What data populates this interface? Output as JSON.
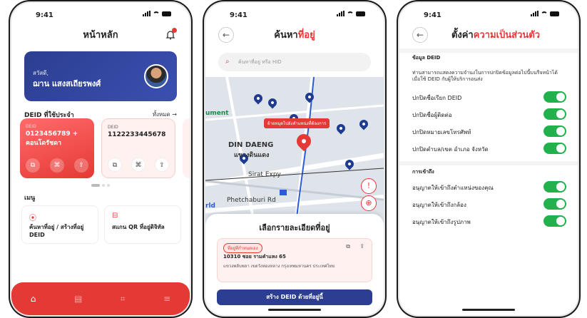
{
  "status": {
    "time": "9:41"
  },
  "home": {
    "title": "หน้าหลัก",
    "greeting": "สวัสดี,",
    "user_name": "ฌาน แสงสเถียรพงศ์",
    "deid_section": "DEID ที่ใช้ประจำ",
    "see_all": "ทั้งหมด →",
    "cards": [
      {
        "label": "DEID",
        "number": "0123456789 + คอนโดรัชดา"
      },
      {
        "label": "DEID",
        "number": "1122233445678"
      }
    ],
    "menu_section": "เมนู",
    "menu": [
      {
        "label": "ค้นหาที่อยู่ / สร้างที่อยู่ DEID"
      },
      {
        "label": "สแกน QR ที่อยู่ดิจิทัล"
      }
    ]
  },
  "search": {
    "title_plain": "ค้นหา",
    "title_accent": "ที่อยู่",
    "placeholder": "ค้นหาที่อยู่ หรือ HID",
    "map_tag": "ย้ายหมุดไปยังตำแหน่งที่ต้องการ",
    "map_labels": [
      "ument",
      "DIN DAENG",
      "แขวงดินแดง",
      "Sirat Expy",
      "Phetchaburi Rd",
      "rld"
    ],
    "sheet_title": "เลือกรายละเอียดที่อยู่",
    "address_badge": "ที่อยู่ที่กำหนดเอง",
    "address_line1": "10310 ซอย รามคำแหง 65",
    "address_line2": "แขวงพลับพลา เขตวังทองหลาง กรุงเทพมหานคร ประเทศไทย",
    "cta": "สร้าง DEID ด้วยที่อยู่นี้"
  },
  "privacy": {
    "title_plain": "ตั้งค่า",
    "title_accent": "ความเป็นส่วนตัว",
    "deid_group": "ข้อมูล DEID",
    "description": "ท่านสามารถแสดงความจำนงในการปกปิดข้อมูลต่อไปนี้บนรีจหน้าได้ เมื่อใช้ DEID กับผู้ให้บริการอนส่ง",
    "toggles": [
      {
        "label": "ปกปิดชื่อเรียก DEID",
        "on": true
      },
      {
        "label": "ปกปิดชื่อผู้ติดต่อ",
        "on": true
      },
      {
        "label": "ปกปิดหมายเลขโทรศัพท์",
        "on": true
      },
      {
        "label": "ปกปิดตำบล/เขต อำเภอ จังหวัด",
        "on": true
      }
    ],
    "access_group": "การเข้าถึง",
    "access": [
      {
        "label": "อนุญาตให้เข้าถึงตำแหน่งของคุณ",
        "on": true
      },
      {
        "label": "อนุญาตให้เข้าถึงกล้อง",
        "on": true
      },
      {
        "label": "อนุญาตให้เข้าถึงรูปภาพ",
        "on": true
      }
    ]
  },
  "colors": {
    "accent": "#e53935",
    "navy": "#2c3e91",
    "toggle_on": "#22b14c"
  }
}
